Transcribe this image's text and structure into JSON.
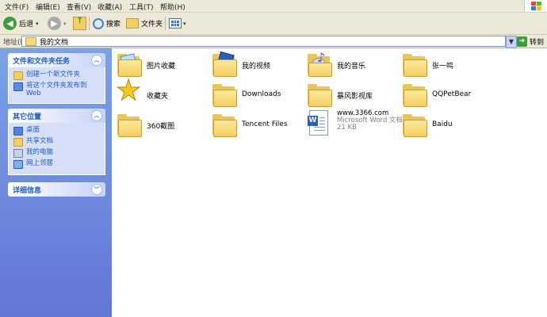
{
  "menu": {
    "items": [
      "文件(F)",
      "编辑(E)",
      "查看(V)",
      "收藏(A)",
      "工具(T)",
      "帮助(H)"
    ]
  },
  "toolbar": {
    "back_label": "后退",
    "search_label": "搜索",
    "folders_label": "文件夹"
  },
  "address": {
    "label": "地址(D)",
    "value": "我的文档",
    "go_label": "转到"
  },
  "left_pane": {
    "tasks": {
      "title": "文件和文件夹任务",
      "links": [
        "创建一个新文件夹",
        "将这个文件夹发布到 Web"
      ]
    },
    "other_places": {
      "title": "其它位置",
      "links": [
        "桌面",
        "共享文档",
        "我的电脑",
        "网上邻居"
      ]
    },
    "details": {
      "title": "详细信息"
    }
  },
  "files": [
    {
      "name": "图片收藏",
      "icon": "pictures-folder-icon"
    },
    {
      "name": "我的视频",
      "icon": "videos-folder-icon"
    },
    {
      "name": "我的音乐",
      "icon": "music-folder-icon"
    },
    {
      "name": "张一鸣",
      "icon": "folder-icon"
    },
    {
      "name": "收藏夹",
      "icon": "favorites-star-icon"
    },
    {
      "name": "Downloads",
      "icon": "folder-icon"
    },
    {
      "name": "暴风影视库",
      "icon": "folder-icon"
    },
    {
      "name": "QQPetBear",
      "icon": "folder-icon"
    },
    {
      "name": "360截图",
      "icon": "folder-icon"
    },
    {
      "name": "Tencent Files",
      "icon": "folder-icon"
    },
    {
      "name": "www.3366.com",
      "type_line": "Microsoft Word 文档",
      "size_line": "21 KB",
      "icon": "word-document-icon"
    },
    {
      "name": "Baidu",
      "icon": "folder-icon"
    }
  ],
  "colors": {
    "left_pane_top": "#7ba2e7",
    "left_pane_bottom": "#6375d6",
    "panel_title": "#215dc6",
    "chrome": "#ece9d8"
  }
}
